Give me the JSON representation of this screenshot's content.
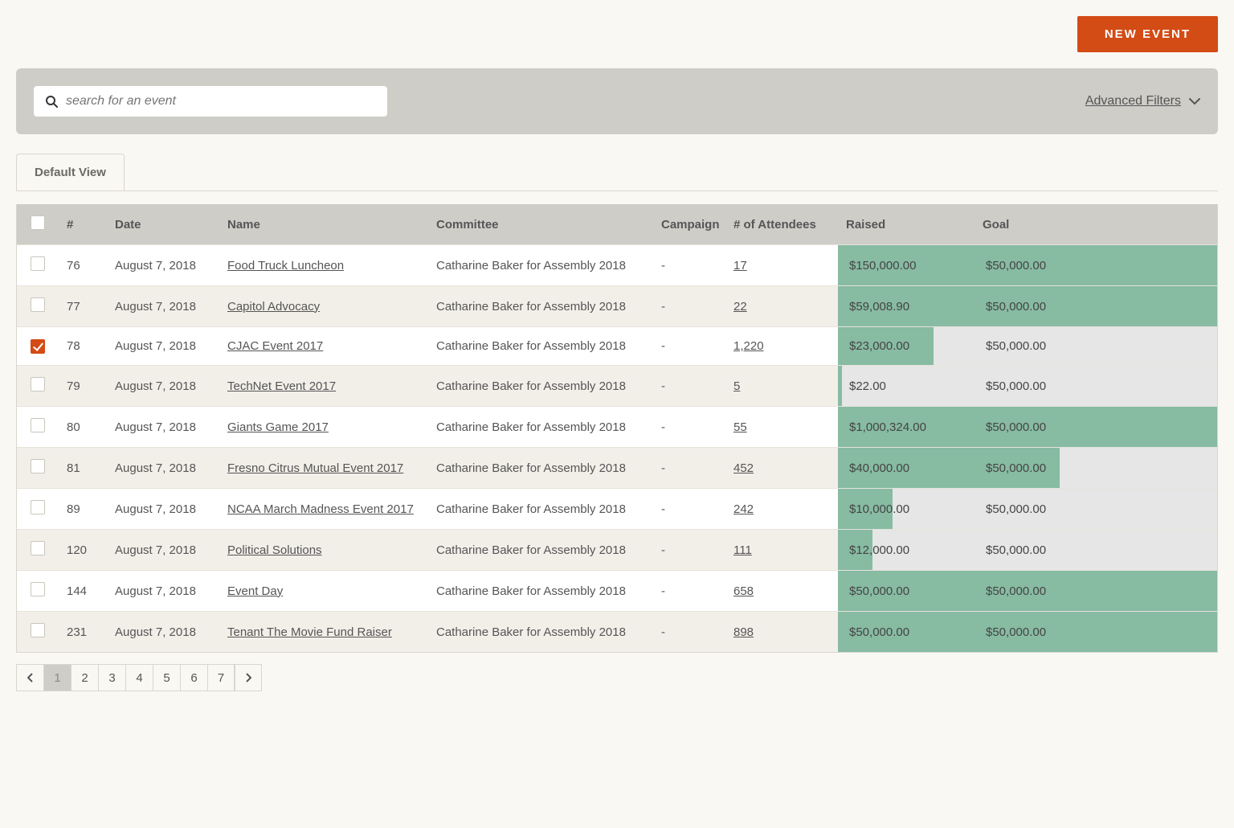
{
  "header": {
    "new_event_label": "NEW EVENT"
  },
  "search": {
    "placeholder": "search for an event"
  },
  "advanced_filters_label": "Advanced Filters",
  "tabs": [
    {
      "label": "Default View",
      "active": true
    }
  ],
  "columns": {
    "num": "#",
    "date": "Date",
    "name": "Name",
    "committee": "Committee",
    "campaign": "Campaign",
    "attendees": "# of Attendees",
    "raised": "Raised",
    "goal": "Goal"
  },
  "rows": [
    {
      "checked": false,
      "num": "76",
      "date": "August 7, 2018",
      "name": "Food Truck Luncheon",
      "committee": "Catharine Baker for Assembly 2018",
      "campaign": "-",
      "attendees": "17",
      "raised": "$150,000.00",
      "raised_pct": 100,
      "goal": "$50,000.00",
      "goal_pct": 100
    },
    {
      "checked": false,
      "num": "77",
      "date": "August 7, 2018",
      "name": "Capitol Advocacy",
      "committee": "Catharine Baker for Assembly 2018",
      "campaign": "-",
      "attendees": "22",
      "raised": "$59,008.90",
      "raised_pct": 100,
      "goal": "$50,000.00",
      "goal_pct": 100
    },
    {
      "checked": true,
      "num": "78",
      "date": "August 7, 2018",
      "name": "CJAC Event 2017",
      "committee": "Catharine Baker for Assembly 2018",
      "campaign": "-",
      "attendees": "1,220",
      "raised": "$23,000.00",
      "raised_pct": 70,
      "goal": "$50,000.00",
      "goal_pct": 0
    },
    {
      "checked": false,
      "num": "79",
      "date": "August 7, 2018",
      "name": "TechNet Event 2017",
      "committee": "Catharine Baker for Assembly 2018",
      "campaign": "-",
      "attendees": "5",
      "raised": "$22.00",
      "raised_pct": 3,
      "goal": "$50,000.00",
      "goal_pct": 0
    },
    {
      "checked": false,
      "num": "80",
      "date": "August 7, 2018",
      "name": "Giants Game 2017",
      "committee": "Catharine Baker for Assembly 2018",
      "campaign": "-",
      "attendees": "55",
      "raised": "$1,000,324.00",
      "raised_pct": 100,
      "goal": "$50,000.00",
      "goal_pct": 100
    },
    {
      "checked": false,
      "num": "81",
      "date": "August 7, 2018",
      "name": "Fresno Citrus Mutual Event 2017",
      "committee": "Catharine Baker for Assembly 2018",
      "campaign": "-",
      "attendees": "452",
      "raised": "$40,000.00",
      "raised_pct": 100,
      "goal": "$50,000.00",
      "goal_pct": 35
    },
    {
      "checked": false,
      "num": "89",
      "date": "August 7, 2018",
      "name": "NCAA March Madness Event 2017",
      "committee": "Catharine Baker for Assembly 2018",
      "campaign": "-",
      "attendees": "242",
      "raised": "$10,000.00",
      "raised_pct": 40,
      "goal": "$50,000.00",
      "goal_pct": 0
    },
    {
      "checked": false,
      "num": "120",
      "date": "August 7, 2018",
      "name": "Political Solutions",
      "committee": "Catharine Baker for Assembly 2018",
      "campaign": "-",
      "attendees": "111",
      "raised": "$12,000.00",
      "raised_pct": 25,
      "goal": "$50,000.00",
      "goal_pct": 0
    },
    {
      "checked": false,
      "num": "144",
      "date": "August 7, 2018",
      "name": "Event Day",
      "committee": "Catharine Baker for Assembly 2018",
      "campaign": "-",
      "attendees": "658",
      "raised": "$50,000.00",
      "raised_pct": 100,
      "goal": "$50,000.00",
      "goal_pct": 100
    },
    {
      "checked": false,
      "num": "231",
      "date": "August 7, 2018",
      "name": "Tenant The Movie Fund Raiser",
      "committee": "Catharine Baker for Assembly 2018",
      "campaign": "-",
      "attendees": "898",
      "raised": "$50,000.00",
      "raised_pct": 100,
      "goal": "$50,000.00",
      "goal_pct": 100
    }
  ],
  "pagination": {
    "current": 1,
    "pages": [
      "1",
      "2",
      "3",
      "4",
      "5",
      "6",
      "7"
    ]
  }
}
